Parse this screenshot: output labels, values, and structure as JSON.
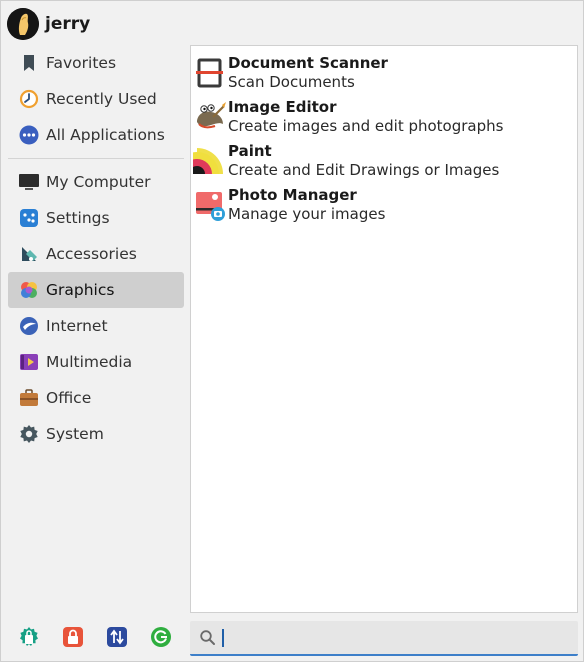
{
  "user": {
    "name": "jerry"
  },
  "categories": [
    {
      "label": "Favorites",
      "icon": "bookmark-icon"
    },
    {
      "label": "Recently Used",
      "icon": "clock-icon"
    },
    {
      "label": "All Applications",
      "icon": "dots-icon"
    },
    {
      "label": "My Computer",
      "icon": "monitor-icon"
    },
    {
      "label": "Settings",
      "icon": "settings-icon"
    },
    {
      "label": "Accessories",
      "icon": "accessories-icon"
    },
    {
      "label": "Graphics",
      "icon": "graphics-icon",
      "active": true
    },
    {
      "label": "Internet",
      "icon": "globe-icon"
    },
    {
      "label": "Multimedia",
      "icon": "multimedia-icon"
    },
    {
      "label": "Office",
      "icon": "briefcase-icon"
    },
    {
      "label": "System",
      "icon": "gear-icon"
    }
  ],
  "apps": [
    {
      "name": "Document Scanner",
      "desc": "Scan Documents",
      "icon": "scanner-icon"
    },
    {
      "name": "Image Editor",
      "desc": "Create images and edit photographs",
      "icon": "gimp-icon"
    },
    {
      "name": "Paint",
      "desc": "Create and Edit Drawings or Images",
      "icon": "paint-icon"
    },
    {
      "name": "Photo Manager",
      "desc": "Manage your images",
      "icon": "photo-manager-icon"
    }
  ],
  "actions": [
    {
      "name": "software-center-icon",
      "color": "#16a085"
    },
    {
      "name": "lock-icon",
      "color": "#e8543a"
    },
    {
      "name": "switch-user-icon",
      "color": "#2c4a9e"
    },
    {
      "name": "logout-icon",
      "color": "#2fae3f"
    }
  ],
  "search": {
    "value": "",
    "placeholder": ""
  }
}
